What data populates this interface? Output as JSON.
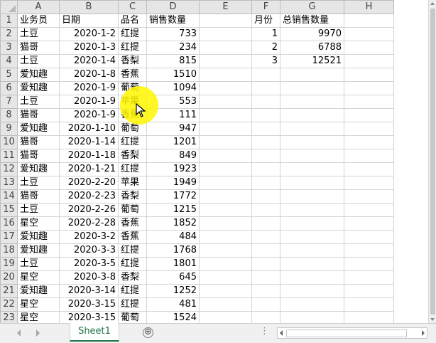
{
  "columns": [
    "A",
    "B",
    "C",
    "D",
    "E",
    "F",
    "G",
    "H"
  ],
  "rows": [
    [
      "1",
      "业务员",
      "日期",
      "品名",
      "销售数量",
      "",
      "月份",
      "总销售数量",
      ""
    ],
    [
      "2",
      "土豆",
      "2020-1-2",
      "红提",
      "733",
      "",
      "1",
      "9970",
      ""
    ],
    [
      "3",
      "猫哥",
      "2020-1-3",
      "红提",
      "234",
      "",
      "2",
      "6788",
      ""
    ],
    [
      "4",
      "土豆",
      "2020-1-4",
      "香梨",
      "815",
      "",
      "3",
      "12521",
      ""
    ],
    [
      "5",
      "爱知趣",
      "2020-1-8",
      "香蕉",
      "1510",
      "",
      "",
      "",
      ""
    ],
    [
      "6",
      "爱知趣",
      "2020-1-9",
      "葡萄",
      "1094",
      "",
      "",
      "",
      ""
    ],
    [
      "7",
      "土豆",
      "2020-1-9",
      "苹果",
      "553",
      "",
      "",
      "",
      ""
    ],
    [
      "8",
      "猫哥",
      "2020-1-9",
      "香蕉",
      "111",
      "",
      "",
      "",
      ""
    ],
    [
      "9",
      "爱知趣",
      "2020-1-10",
      "葡萄",
      "947",
      "",
      "",
      "",
      ""
    ],
    [
      "10",
      "猫哥",
      "2020-1-14",
      "红提",
      "1201",
      "",
      "",
      "",
      ""
    ],
    [
      "11",
      "猫哥",
      "2020-1-18",
      "香梨",
      "849",
      "",
      "",
      "",
      ""
    ],
    [
      "12",
      "爱知趣",
      "2020-1-21",
      "红提",
      "1923",
      "",
      "",
      "",
      ""
    ],
    [
      "13",
      "土豆",
      "2020-2-20",
      "苹果",
      "1949",
      "",
      "",
      "",
      ""
    ],
    [
      "14",
      "猫哥",
      "2020-2-23",
      "香梨",
      "1772",
      "",
      "",
      "",
      ""
    ],
    [
      "15",
      "土豆",
      "2020-2-26",
      "葡萄",
      "1215",
      "",
      "",
      "",
      ""
    ],
    [
      "16",
      "星空",
      "2020-2-28",
      "香蕉",
      "1852",
      "",
      "",
      "",
      ""
    ],
    [
      "17",
      "爱知趣",
      "2020-3-2",
      "香蕉",
      "484",
      "",
      "",
      "",
      ""
    ],
    [
      "18",
      "爱知趣",
      "2020-3-3",
      "红提",
      "1768",
      "",
      "",
      "",
      ""
    ],
    [
      "19",
      "土豆",
      "2020-3-5",
      "红提",
      "1801",
      "",
      "",
      "",
      ""
    ],
    [
      "20",
      "星空",
      "2020-3-8",
      "香梨",
      "645",
      "",
      "",
      "",
      ""
    ],
    [
      "21",
      "爱知趣",
      "2020-3-14",
      "红提",
      "1252",
      "",
      "",
      "",
      ""
    ],
    [
      "22",
      "星空",
      "2020-3-15",
      "红提",
      "481",
      "",
      "",
      "",
      ""
    ],
    [
      "23",
      "星空",
      "2020-3-15",
      "葡萄",
      "1524",
      "",
      "",
      "",
      ""
    ]
  ],
  "sheet_tab": "Sheet1",
  "add_sheet_icon": "⊕",
  "tab_more": "⋮",
  "icons": {
    "cursor": "mouse-pointer-icon",
    "cursor_highlight_color": "#fff700"
  },
  "colors": {
    "accent": "#217346",
    "header_bg": "#e6e6e6",
    "gridline": "#d4d4d4"
  }
}
